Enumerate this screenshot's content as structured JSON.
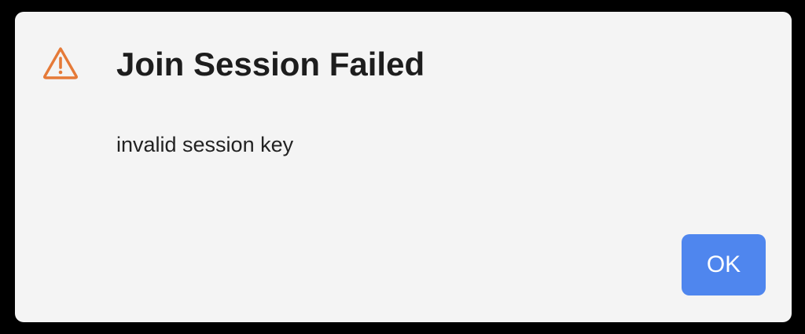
{
  "dialog": {
    "icon": "warning-triangle-icon",
    "title": "Join Session Failed",
    "message": "invalid session key",
    "ok_label": "OK"
  },
  "colors": {
    "icon": "#e57a38",
    "button": "#4f86ee",
    "background": "#f4f4f4"
  }
}
